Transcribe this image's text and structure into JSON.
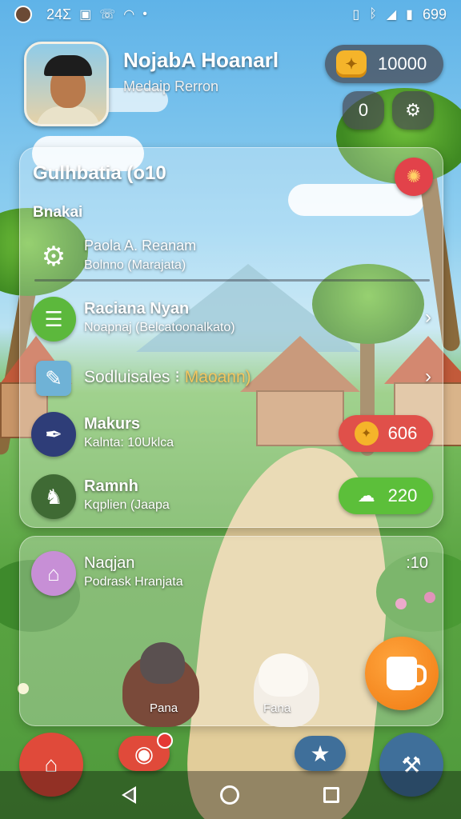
{
  "status_bar": {
    "time": "24Σ",
    "battery": "699"
  },
  "profile": {
    "name": "NojabA Hoanarl",
    "subtitle": "Medaip Rerron"
  },
  "currency": {
    "value": "10000"
  },
  "header_buttons": {
    "left_glyph": "0"
  },
  "panel": {
    "title": "Gulhbatia (o10",
    "section_label": "Bnakai",
    "rows": [
      {
        "title": "Paola A. Reanam",
        "subtitle": "Bolnno (Marajata)",
        "icon": "gear-icon"
      },
      {
        "title": "Raciana Nyan",
        "subtitle": "Noapnaj (Belcatoonalkato)",
        "icon": "checklist-icon"
      },
      {
        "title": "Sodluisales",
        "title_suffix": "Maoann)",
        "icon": "map-icon"
      },
      {
        "title": "Makurs",
        "subtitle": "Kalnta: 10Uklca",
        "icon": "quill-icon",
        "reward": "606"
      },
      {
        "title": "Ramnh",
        "subtitle": "Kqplien (Jaapa",
        "icon": "pet-icon",
        "reward": "220"
      }
    ]
  },
  "card2": {
    "title": "Naqjan",
    "subtitle": "Podrask Hranjata",
    "time": ":10",
    "pets": [
      "Pana",
      "Fana"
    ]
  },
  "colors": {
    "close_red": "#e2424a",
    "reward_red": "#e0504a",
    "reward_green": "#5cbf3a",
    "fab_orange": "#f07a12",
    "coin_gold": "#f5b42a"
  }
}
